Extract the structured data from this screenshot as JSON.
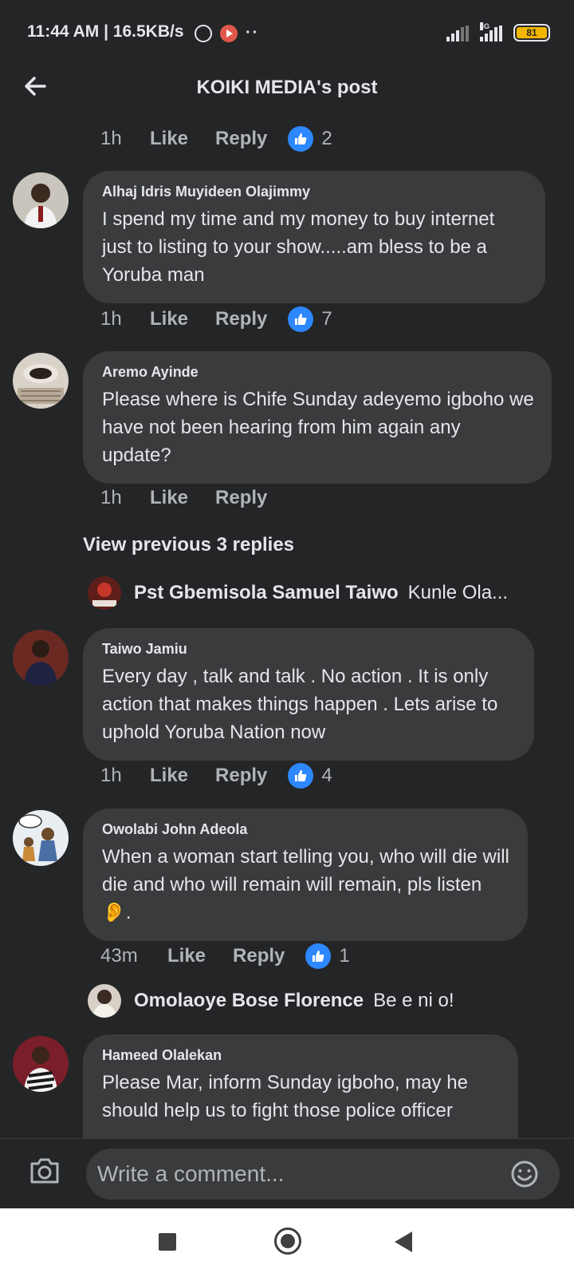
{
  "status_bar": {
    "time": "11:44 AM | 16.5KB/s",
    "network": "4G",
    "battery": "81"
  },
  "header": {
    "title": "KOIKI MEDIA's post"
  },
  "top_meta": {
    "time": "1h",
    "like": "Like",
    "reply": "Reply",
    "reactions": "2"
  },
  "comments": [
    {
      "author": "Alhaj Idris Muyideen Olajimmy",
      "text": "I spend my time and my money to buy internet just to listing to your show.....am bless to be a Yoruba man",
      "time": "1h",
      "like": "Like",
      "reply": "Reply",
      "reactions": "7"
    },
    {
      "author": "Aremo Ayinde",
      "text": "Please where is Chife Sunday adeyemo igboho we have not been hearing from him again any update?",
      "time": "1h",
      "like": "Like",
      "reply": "Reply",
      "view_previous": "View previous 3 replies",
      "reply_preview": {
        "name": "Pst Gbemisola Samuel Taiwo",
        "text": "Kunle Ola..."
      }
    },
    {
      "author": "Taiwo Jamiu",
      "text": "Every day , talk and talk . No action . It is only action that makes things happen . Lets arise to uphold Yoruba Nation now",
      "time": "1h",
      "like": "Like",
      "reply": "Reply",
      "reactions": "4"
    },
    {
      "author": "Owolabi John Adeola",
      "text": "When a woman start telling you, who will die will die and who will remain will remain, pls listen 👂.",
      "time": "43m",
      "like": "Like",
      "reply": "Reply",
      "reactions": "1",
      "reply_preview": {
        "name": "Omolaoye Bose Florence",
        "text": "Be e ni o!"
      }
    },
    {
      "author": "Hameed Olalekan",
      "text": "Please Mar,  inform Sunday igboho, may he should help us to fight those police officer"
    }
  ],
  "composer": {
    "placeholder": "Write a comment..."
  },
  "colors": {
    "background": "#242526",
    "bubble": "#3a3b3c",
    "like_blue": "#2d88ff",
    "secondary_text": "#b0b3b8"
  }
}
